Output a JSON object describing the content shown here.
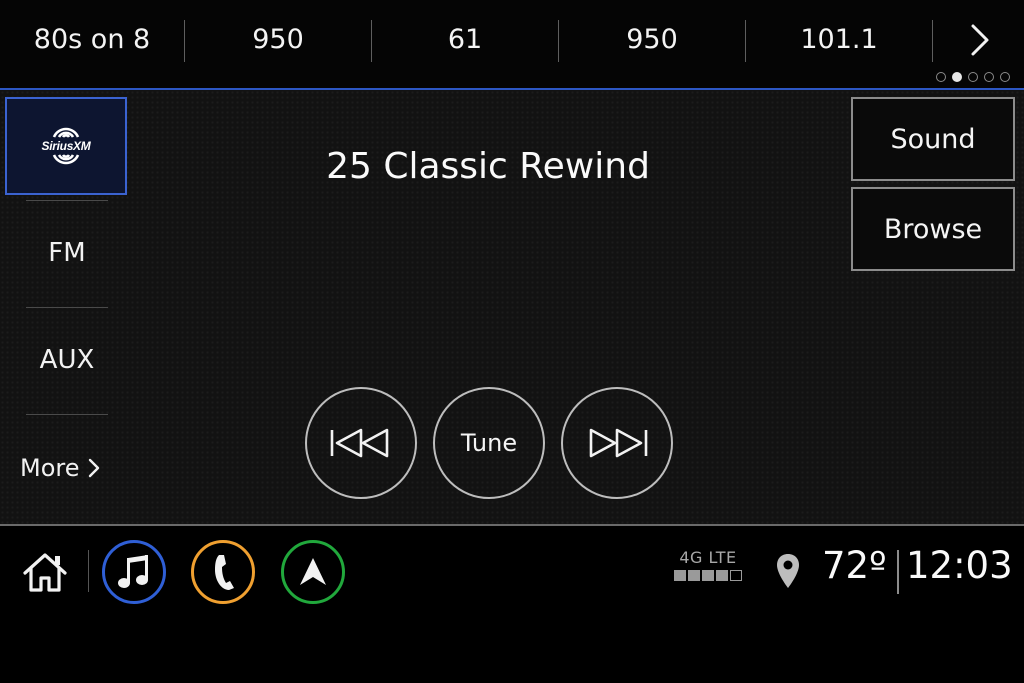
{
  "presets": [
    {
      "label": "80s on 8"
    },
    {
      "label": "950"
    },
    {
      "label": "61"
    },
    {
      "label": "950"
    },
    {
      "label": "101.1"
    }
  ],
  "preset_page": {
    "current": 2,
    "total": 5
  },
  "sources": {
    "siriusxm_logo_text": "SiriusXM",
    "fm_label": "FM",
    "aux_label": "AUX",
    "more_label": "More"
  },
  "now_playing": {
    "station": "25 Classic Rewind"
  },
  "side_buttons": {
    "sound_label": "Sound",
    "browse_label": "Browse"
  },
  "controls": {
    "tune_label": "Tune"
  },
  "status": {
    "network_label": "4G LTE",
    "signal_bars": 4,
    "signal_bars_total": 5,
    "temperature": "72º",
    "time": "12:03"
  },
  "colors": {
    "accent_blue": "#2d57c4",
    "audio_ring": "#2f5fd6",
    "phone_ring": "#f0a030",
    "nav_ring": "#21a83c"
  },
  "icons": {
    "home": "home-icon",
    "audio": "music-note-icon",
    "phone": "phone-icon",
    "nav": "navigation-arrow-icon",
    "location": "location-pin-icon",
    "prev": "seek-back-icon",
    "next": "seek-forward-icon",
    "presets_next": "chevron-right-icon"
  }
}
